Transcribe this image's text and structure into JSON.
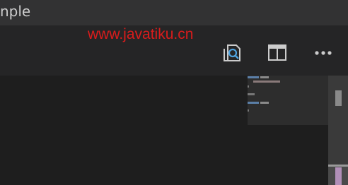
{
  "window": {
    "title_fragment": "nple"
  },
  "watermark": {
    "text": "www.javatiku.cn"
  },
  "toolbar": {
    "actions": [
      {
        "icon": "open-preview-icon"
      },
      {
        "icon": "split-editor-icon"
      },
      {
        "icon": "more-actions-icon"
      }
    ]
  },
  "colors": {
    "titlebar": "#323233",
    "tabbar": "#252526",
    "editor": "#1e1e1e",
    "watermark": "#d91c1c",
    "preview_icon_accent": "#4fa3e0"
  }
}
